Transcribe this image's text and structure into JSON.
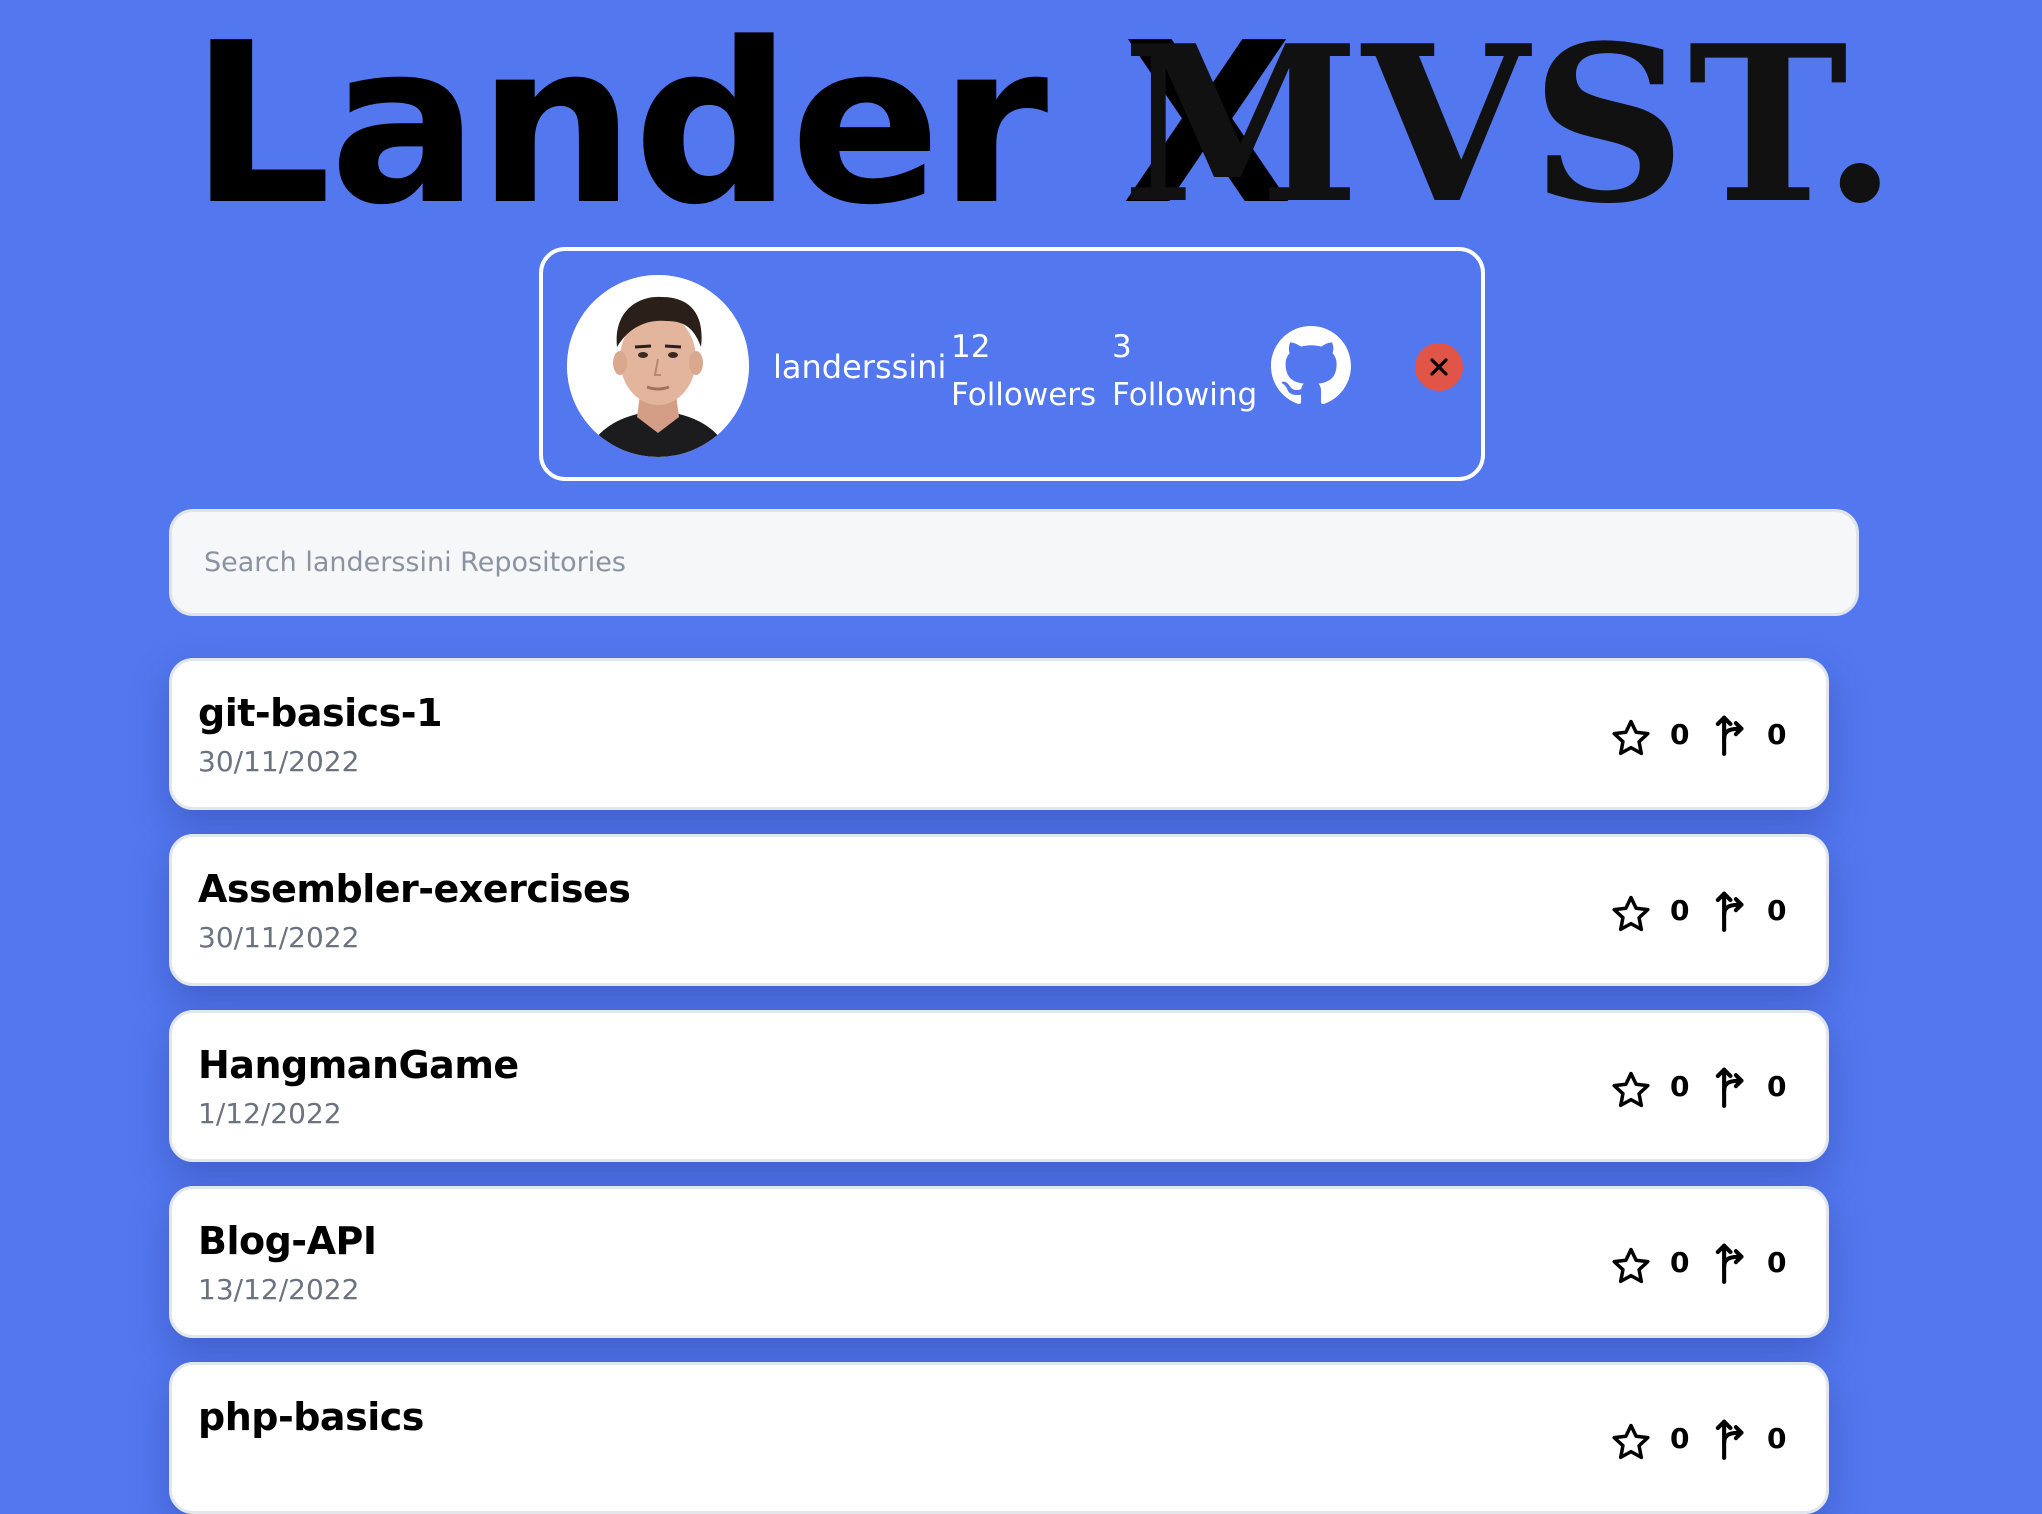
{
  "header": {
    "title_left": "Lander X",
    "title_right": "MVST."
  },
  "profile": {
    "username": "landerssini",
    "followers_count": "12",
    "followers_label": "Followers",
    "following_count": "3",
    "following_label": "Following",
    "avatar_icon": "user-avatar",
    "github_icon": "github-icon",
    "close_icon": "close-icon",
    "close_color": "#e05548"
  },
  "search": {
    "placeholder": "Search landerssini Repositories",
    "value": ""
  },
  "repositories": [
    {
      "name": "git-basics-1",
      "date": "30/11/2022",
      "stars": "0",
      "forks": "0"
    },
    {
      "name": "Assembler-exercises",
      "date": "30/11/2022",
      "stars": "0",
      "forks": "0"
    },
    {
      "name": "HangmanGame",
      "date": "1/12/2022",
      "stars": "0",
      "forks": "0"
    },
    {
      "name": "Blog-API",
      "date": "13/12/2022",
      "stars": "0",
      "forks": "0"
    },
    {
      "name": "php-basics",
      "date": "",
      "stars": "0",
      "forks": "0"
    }
  ],
  "colors": {
    "background": "#5277ee",
    "card_background": "#ffffff",
    "text_primary": "#000000",
    "text_secondary": "#6b7280"
  }
}
